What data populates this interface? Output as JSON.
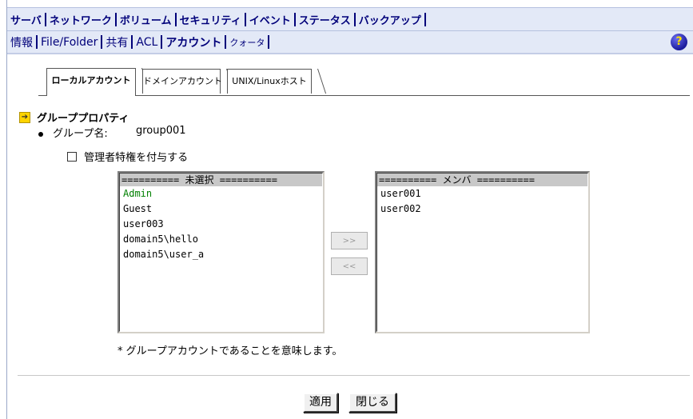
{
  "nav_main": [
    "サーバ",
    "ネットワーク",
    "ボリューム",
    "セキュリティ",
    "イベント",
    "ステータス",
    "バックアップ"
  ],
  "nav_sub": [
    "情報",
    "File/Folder",
    "共有",
    "ACL",
    "アカウント",
    "クォータ"
  ],
  "help_label": "?",
  "tabs": [
    "ローカルアカウント",
    "ドメインアカウント",
    "UNIX/Linuxホスト"
  ],
  "section_title": "グループプロパティ",
  "group_name_label": "グループ名:",
  "group_name_value": "group001",
  "admin_checkbox_label": "管理者特権を付与する",
  "unselected_header": "========== 未選択 ==========",
  "unselected_items": [
    "Admin",
    "Guest",
    "user003",
    "domain5\\hello",
    "domain5\\user_a"
  ],
  "add_button": ">>",
  "remove_button": "<<",
  "members_header": "========== メンバ ==========",
  "member_items": [
    "user001",
    "user002"
  ],
  "footnote": "* グループアカウントであることを意味します。",
  "apply_button": "適用",
  "close_button": "閉じる",
  "colors": {
    "nav_bg": "#e3e9f7",
    "nav_text": "#00007a",
    "group_account": "#008000"
  }
}
